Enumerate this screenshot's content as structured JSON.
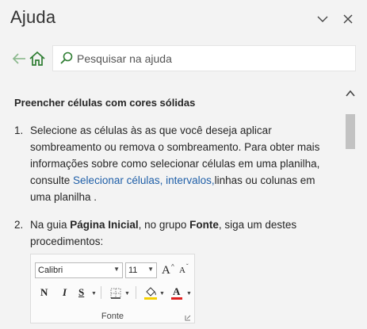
{
  "header": {
    "title": "Ajuda"
  },
  "search": {
    "placeholder": "Pesquisar na ajuda"
  },
  "article": {
    "title": "Preencher células com cores sólidas",
    "steps": [
      {
        "number": "1.",
        "text_before": "Selecione as células às as que você deseja aplicar sombreamento ou remova o sombreamento. Para obter mais informações sobre como selecionar células em uma planilha, consulte ",
        "link": "Selecionar células, intervalos,",
        "text_after": "linhas ou colunas em uma planilha ."
      },
      {
        "number": "2.",
        "text_1": "Na guia ",
        "bold_1": "Página Inicial",
        "text_2": ", no grupo ",
        "bold_2": "Fonte",
        "text_3": ", siga um destes procedimentos:"
      }
    ]
  },
  "ribbon": {
    "font_name": "Calibri",
    "font_size": "11",
    "grow_label": "A",
    "shrink_label": "A",
    "bold_label": "N",
    "italic_label": "I",
    "underline_label": "S",
    "group_label": "Fonte",
    "fill_color": "#f5d000",
    "font_color": "#e02020"
  },
  "colors": {
    "accent": "#2e7d32",
    "link": "#1f5fa8"
  }
}
